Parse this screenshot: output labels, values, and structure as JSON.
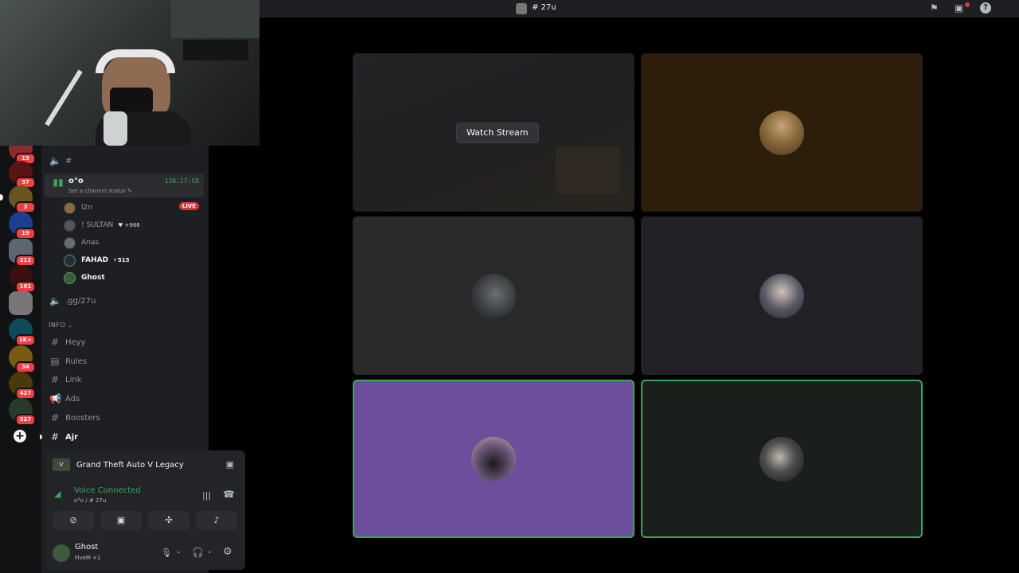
{
  "header": {
    "channel_title": "# 27u"
  },
  "rail": {
    "badges": [
      "13",
      "37",
      "3",
      "19",
      "212",
      "161",
      "1K+",
      "34",
      "427",
      "527"
    ]
  },
  "sidebar": {
    "top_channel": "#",
    "active_channel": {
      "name": "o°o",
      "timer": "130:27:58",
      "status_placeholder": "Set a channel status"
    },
    "voice_users": [
      {
        "name": "l2n",
        "live": "LIVE"
      },
      {
        "name": "! SULTAN",
        "tag": "+966"
      },
      {
        "name": "Anas"
      },
      {
        "name": "FAHAD",
        "tag": "515"
      },
      {
        "name": "Ghost"
      }
    ],
    "invite_channel": ".gg/27u",
    "category": "INFO",
    "channels": [
      {
        "name": "Heyy",
        "icon": "hash-icon"
      },
      {
        "name": "Rules",
        "icon": "rules-icon"
      },
      {
        "name": "Link",
        "icon": "hash-icon"
      },
      {
        "name": "Ads",
        "icon": "megaphone-icon"
      },
      {
        "name": "Boosters",
        "icon": "hash-icon"
      },
      {
        "name": "Ajr",
        "icon": "hash-icon"
      }
    ]
  },
  "activity": {
    "game": "Grand Theft Auto V Legacy"
  },
  "voice": {
    "status": "Voice Connected",
    "location": "o°o / # 27u"
  },
  "user": {
    "name": "Ghost",
    "activity": "FiveM +1"
  },
  "stage": {
    "watch_label": "Watch Stream"
  },
  "colors": {
    "accent_green": "#3ba55c",
    "danger_red": "#da373c",
    "tile_purple": "#6b4f9c",
    "tile_brown": "#2c1e0b"
  }
}
